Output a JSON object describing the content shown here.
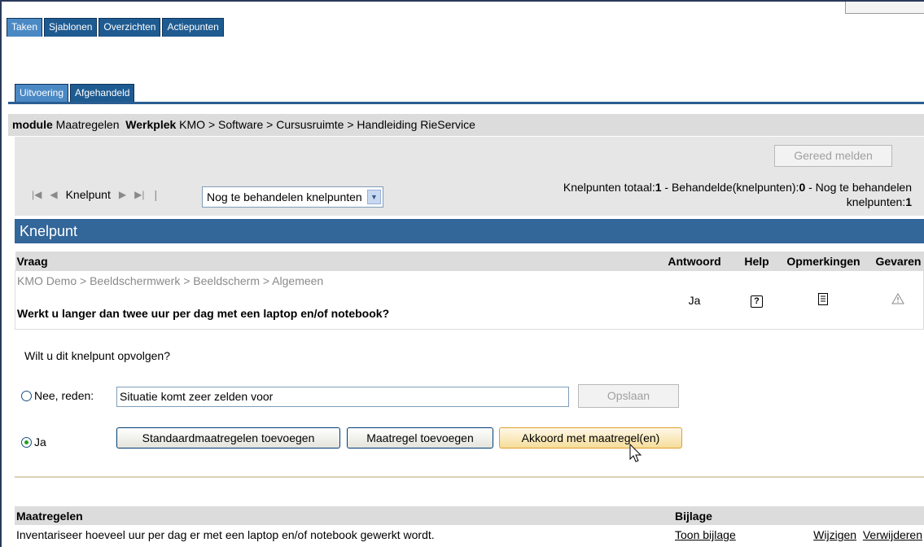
{
  "tabs_main": [
    "Taken",
    "Sjablonen",
    "Overzichten",
    "Actiepunten"
  ],
  "tabs_sub": [
    "Uitvoering",
    "Afgehandeld"
  ],
  "breadcrumb": {
    "module_label": "module",
    "module_value": "Maatregelen",
    "werkplek_label": "Werkplek",
    "werkplek_value": "KMO > Software > Cursusruimte > Handleiding RieService"
  },
  "gereed_button": "Gereed melden",
  "nav": {
    "first_icon": "first-page-icon",
    "prev_icon": "prev-icon",
    "label": "Knelpunt",
    "next_icon": "next-icon",
    "last_icon": "last-page-icon",
    "separator": "|"
  },
  "filter_select": "Nog te behandelen knelpunten",
  "totals": {
    "totaal_label": "Knelpunten totaal:",
    "totaal_value": "1",
    "behandeld_label": " - Behandelde(knelpunten):",
    "behandeld_value": "0",
    "nog_label": " - Nog te behandelen",
    "nog_label2": "knelpunten:",
    "nog_value": "1"
  },
  "knelpunt_header": "Knelpunt",
  "question_table": {
    "headers": [
      "Vraag",
      "Antwoord",
      "Help",
      "Opmerkingen",
      "Gevaren"
    ],
    "path": "KMO Demo > Beeldschermwerk > Beeldscherm > Algemeen",
    "question": "Werkt u langer dan twee uur per dag met een laptop en/of notebook?",
    "answer": "Ja",
    "help_icon": "help-icon",
    "notes_icon": "notes-icon",
    "hazard_icon": "warning-icon"
  },
  "follow_question": "Wilt u dit knelpunt opvolgen?",
  "nee": {
    "label": "Nee, reden:",
    "reason": "Situatie komt zeer zelden voor",
    "save_button": "Opslaan"
  },
  "ja": {
    "label": "Ja",
    "btn_standard": "Standaardmaatregelen toevoegen",
    "btn_add": "Maatregel toevoegen",
    "btn_agree": "Akkoord met maatregel(en)"
  },
  "measures_table": {
    "headers": [
      "Maatregelen",
      "Bijlage"
    ],
    "rows": [
      {
        "text": "Inventariseer hoeveel uur per dag er met een laptop en/of notebook gewerkt wordt.",
        "attachment_link": "Toon bijlage",
        "edit_link": "Wijzigen",
        "delete_link": "Verwijderen"
      }
    ]
  },
  "colors": {
    "tab_blue": "#1e5b91",
    "header_blue": "#336699",
    "panel_gray": "#e6e6e6"
  }
}
